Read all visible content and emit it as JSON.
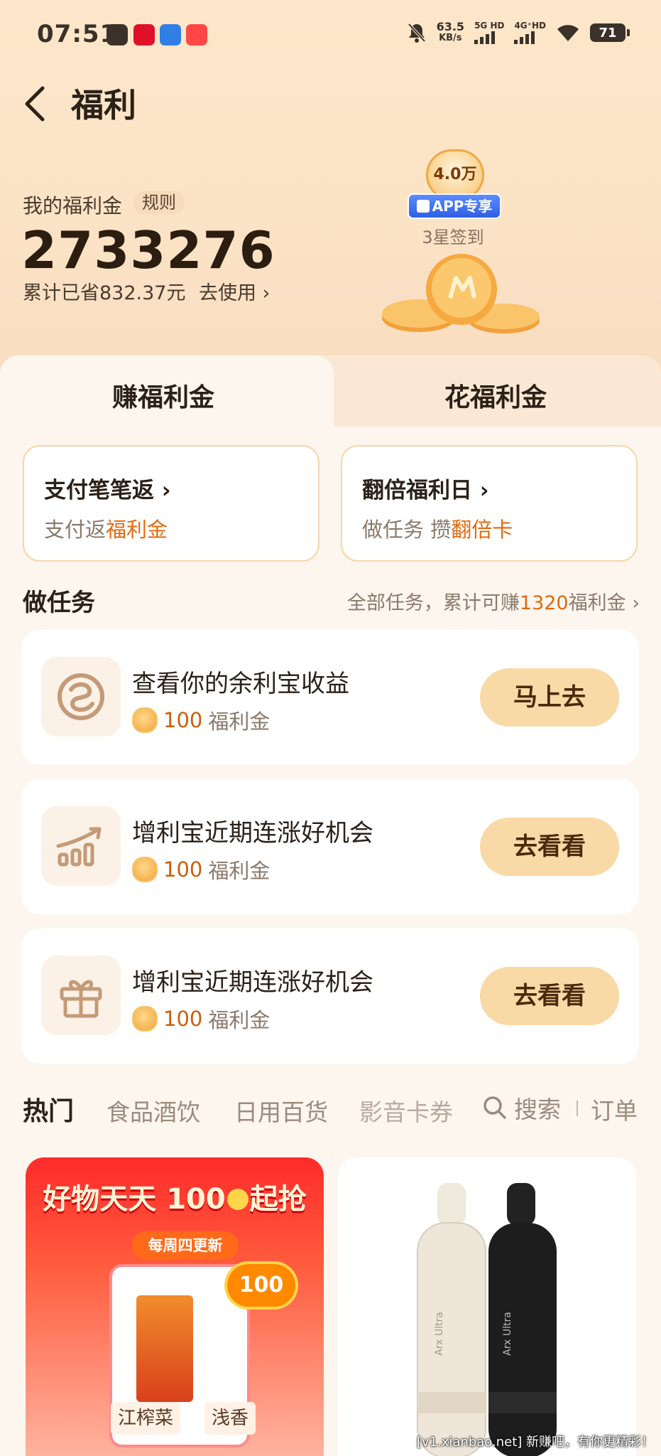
{
  "status_bar": {
    "time": "07:51",
    "net_speed_value": "63.5",
    "net_speed_unit": "KB/s",
    "sig1_label": "5G HD",
    "sig2_label": "4G⁺HD",
    "battery": "71"
  },
  "header": {
    "title": "福利"
  },
  "balance": {
    "label": "我的福利金",
    "rules_label": "规则",
    "value": "2733276",
    "savings_text": "累计已省832.37元",
    "use_label": "去使用 ›"
  },
  "checkin": {
    "amount": "4.0万",
    "app_badge": "APP专享",
    "label": "3星签到"
  },
  "tabs": [
    {
      "label": "赚福利金"
    },
    {
      "label": "花福利金"
    }
  ],
  "features": [
    {
      "title": "支付笔笔返 ›",
      "sub_prefix": "支付返",
      "sub_highlight": "福利金"
    },
    {
      "title": "翻倍福利日 ›",
      "sub_prefix": "做任务 攒",
      "sub_highlight": "翻倍卡"
    }
  ],
  "tasks_section": {
    "title": "做任务",
    "summary_prefix": "全部任务，累计可赚",
    "summary_amount": "1320",
    "summary_suffix": "福利金 ›"
  },
  "tasks": [
    {
      "title": "查看你的余利宝收益",
      "reward_amount": "100",
      "reward_unit": "福利金",
      "button": "马上去",
      "icon": "yulibao-icon"
    },
    {
      "title": "增利宝近期连涨好机会",
      "reward_amount": "100",
      "reward_unit": "福利金",
      "button": "去看看",
      "icon": "trend-chart-icon"
    },
    {
      "title": "增利宝近期连涨好机会",
      "reward_amount": "100",
      "reward_unit": "福利金",
      "button": "去看看",
      "icon": "gift-icon"
    }
  ],
  "categories": {
    "items": [
      "热门",
      "食品酒饮",
      "日用百货",
      "影音卡券"
    ],
    "search_label": "搜索",
    "orders_label": "订单"
  },
  "products": {
    "promo_title": "好物天天 100",
    "promo_title_suffix": "起抢",
    "promo_tag": "每周四更新",
    "promo_badge": "100",
    "promo_item1": "江榨菜",
    "promo_item2": "浅香",
    "umbrella_brand": "Arx Ultra"
  },
  "watermark": "[v1.xianbao.net] 新赚吧，有你更精彩！",
  "colors": {
    "accent_orange": "#e06a12",
    "button_bg": "#f9d9a5",
    "header_bg": "#fde6c9"
  }
}
